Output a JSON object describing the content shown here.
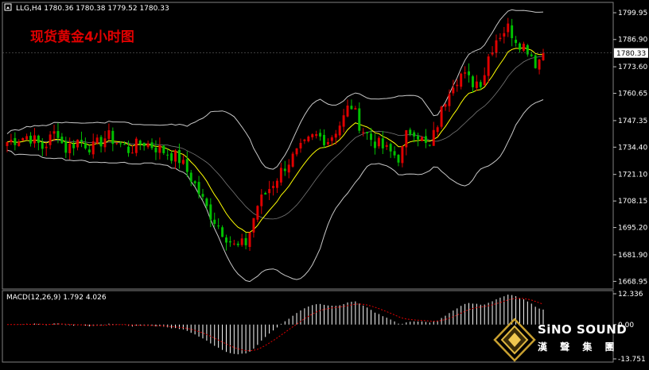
{
  "header": {
    "symbol_line": "LLG,H4  1780.36 1780.38 1779.52 1780.33",
    "title_cn": "现货黄金4小时图"
  },
  "macd_label": "MACD(12,26,9) 1.792 4.026",
  "price_tag": "1780.33",
  "brand": {
    "name": "SiNO SOUND",
    "chinese": "漢 聲 集 團"
  },
  "colors": {
    "background": "#000000",
    "bull": "#e00000",
    "bear": "#00c000",
    "ma": "#ffff00",
    "bands": "#c8c8c8",
    "macd_hist": "#ffffff",
    "macd_signal": "#e00000",
    "title": "#e00000",
    "logo_gold": "#c8a030"
  },
  "chart_data": [
    {
      "type": "candlestick",
      "title": "现货黄金4小时图",
      "symbol": "LLG",
      "timeframe": "H4",
      "last": {
        "open": 1780.36,
        "high": 1780.38,
        "low": 1779.52,
        "close": 1780.33
      },
      "ylim": [
        1666,
        1805
      ],
      "yticks": [
        1799.95,
        1786.9,
        1773.6,
        1760.65,
        1747.35,
        1734.4,
        1721.1,
        1708.15,
        1695.2,
        1681.9,
        1668.95
      ],
      "ytick_labels": [
        "1799.95",
        "1786.90",
        "1773.60",
        "1760.65",
        "1747.35",
        "1734.40",
        "1721.10",
        "1708.15",
        "1695.20",
        "1681.90",
        "1668.95"
      ],
      "grid": false,
      "indicators": [
        "Moving Average",
        "Bollinger Bands"
      ],
      "candle_count": 138,
      "close_path_anchors": [
        [
          0,
          1737
        ],
        [
          6,
          1740
        ],
        [
          10,
          1734
        ],
        [
          14,
          1743
        ],
        [
          16,
          1733
        ],
        [
          20,
          1738
        ],
        [
          24,
          1734
        ],
        [
          28,
          1740
        ],
        [
          34,
          1733
        ],
        [
          38,
          1737
        ],
        [
          42,
          1734
        ],
        [
          48,
          1729
        ],
        [
          52,
          1718
        ],
        [
          56,
          1704
        ],
        [
          60,
          1694
        ],
        [
          64,
          1685
        ],
        [
          67,
          1688
        ],
        [
          70,
          1706
        ],
        [
          74,
          1716
        ],
        [
          78,
          1726
        ],
        [
          82,
          1733
        ],
        [
          86,
          1740
        ],
        [
          90,
          1738
        ],
        [
          94,
          1748
        ],
        [
          96,
          1756
        ],
        [
          99,
          1744
        ],
        [
          102,
          1738
        ],
        [
          106,
          1733
        ],
        [
          110,
          1729
        ],
        [
          112,
          1742
        ],
        [
          114,
          1743
        ],
        [
          118,
          1733
        ],
        [
          121,
          1749
        ],
        [
          124,
          1765
        ],
        [
          127,
          1770
        ],
        [
          130,
          1766
        ],
        [
          133,
          1767
        ],
        [
          135,
          1781
        ],
        [
          137,
          1788
        ],
        [
          140,
          1793
        ],
        [
          143,
          1786
        ],
        [
          146,
          1782
        ],
        [
          148,
          1775
        ],
        [
          150,
          1780
        ]
      ],
      "current_price": 1780.33
    },
    {
      "type": "histogram",
      "title": "MACD(12,26,9) 1.792 4.026",
      "indicator": "MACD(12,26,9)",
      "main": 1.792,
      "signal": 4.026,
      "ylim": [
        -13.751,
        12.336
      ],
      "yticks": [
        12.336,
        0.0,
        -13.751
      ],
      "ytick_labels": [
        "12.336",
        "0.00",
        "-13.751"
      ]
    }
  ]
}
